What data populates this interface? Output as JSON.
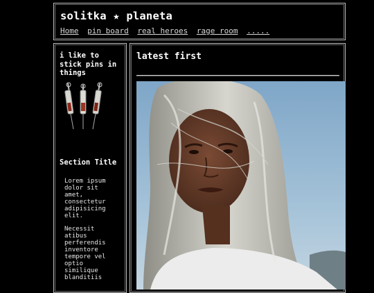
{
  "header": {
    "title": "solitka ★ planeta",
    "nav": [
      "Home",
      "pin board",
      "real heroes",
      "rage room",
      "....."
    ]
  },
  "sidebar": {
    "heading": "i like to stick pins in things",
    "section_title": "Section Title",
    "paragraphs": [
      "Lorem ipsum dolor sit amet, consectetur adipisicing elit.",
      "Necessit atibus perferendis inventore tempore vel optio similique blanditiis"
    ]
  },
  "main": {
    "heading": "latest first"
  }
}
